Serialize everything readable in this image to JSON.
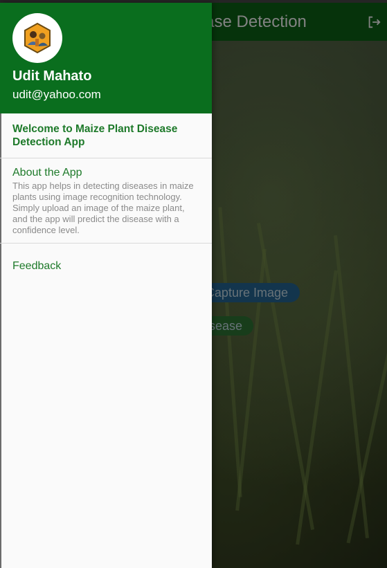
{
  "app_bar": {
    "title": "Maize Plant Disease Detection",
    "logout_icon": "logout-icon"
  },
  "buttons": {
    "capture_label": "Capture Image",
    "predict_label": "Predict Disease"
  },
  "drawer": {
    "header": {
      "avatar_icon": "farmer-avatar-icon",
      "name": "Udit Mahato",
      "email": "udit@yahoo.com"
    },
    "items": [
      {
        "label": "Welcome to Maize Plant Disease Detection App"
      },
      {
        "title": "About the App",
        "body": "This app helps in detecting diseases in maize plants using image recognition technology. Simply upload an image of the maize plant, and the app will predict the disease with a confidence level."
      },
      {
        "label": "Feedback"
      }
    ]
  },
  "colors": {
    "header_green": "#0a6e1e",
    "appbar_green": "#0a4f12",
    "link_green": "#1e7a2a",
    "capture_blue": "#1e5277"
  }
}
